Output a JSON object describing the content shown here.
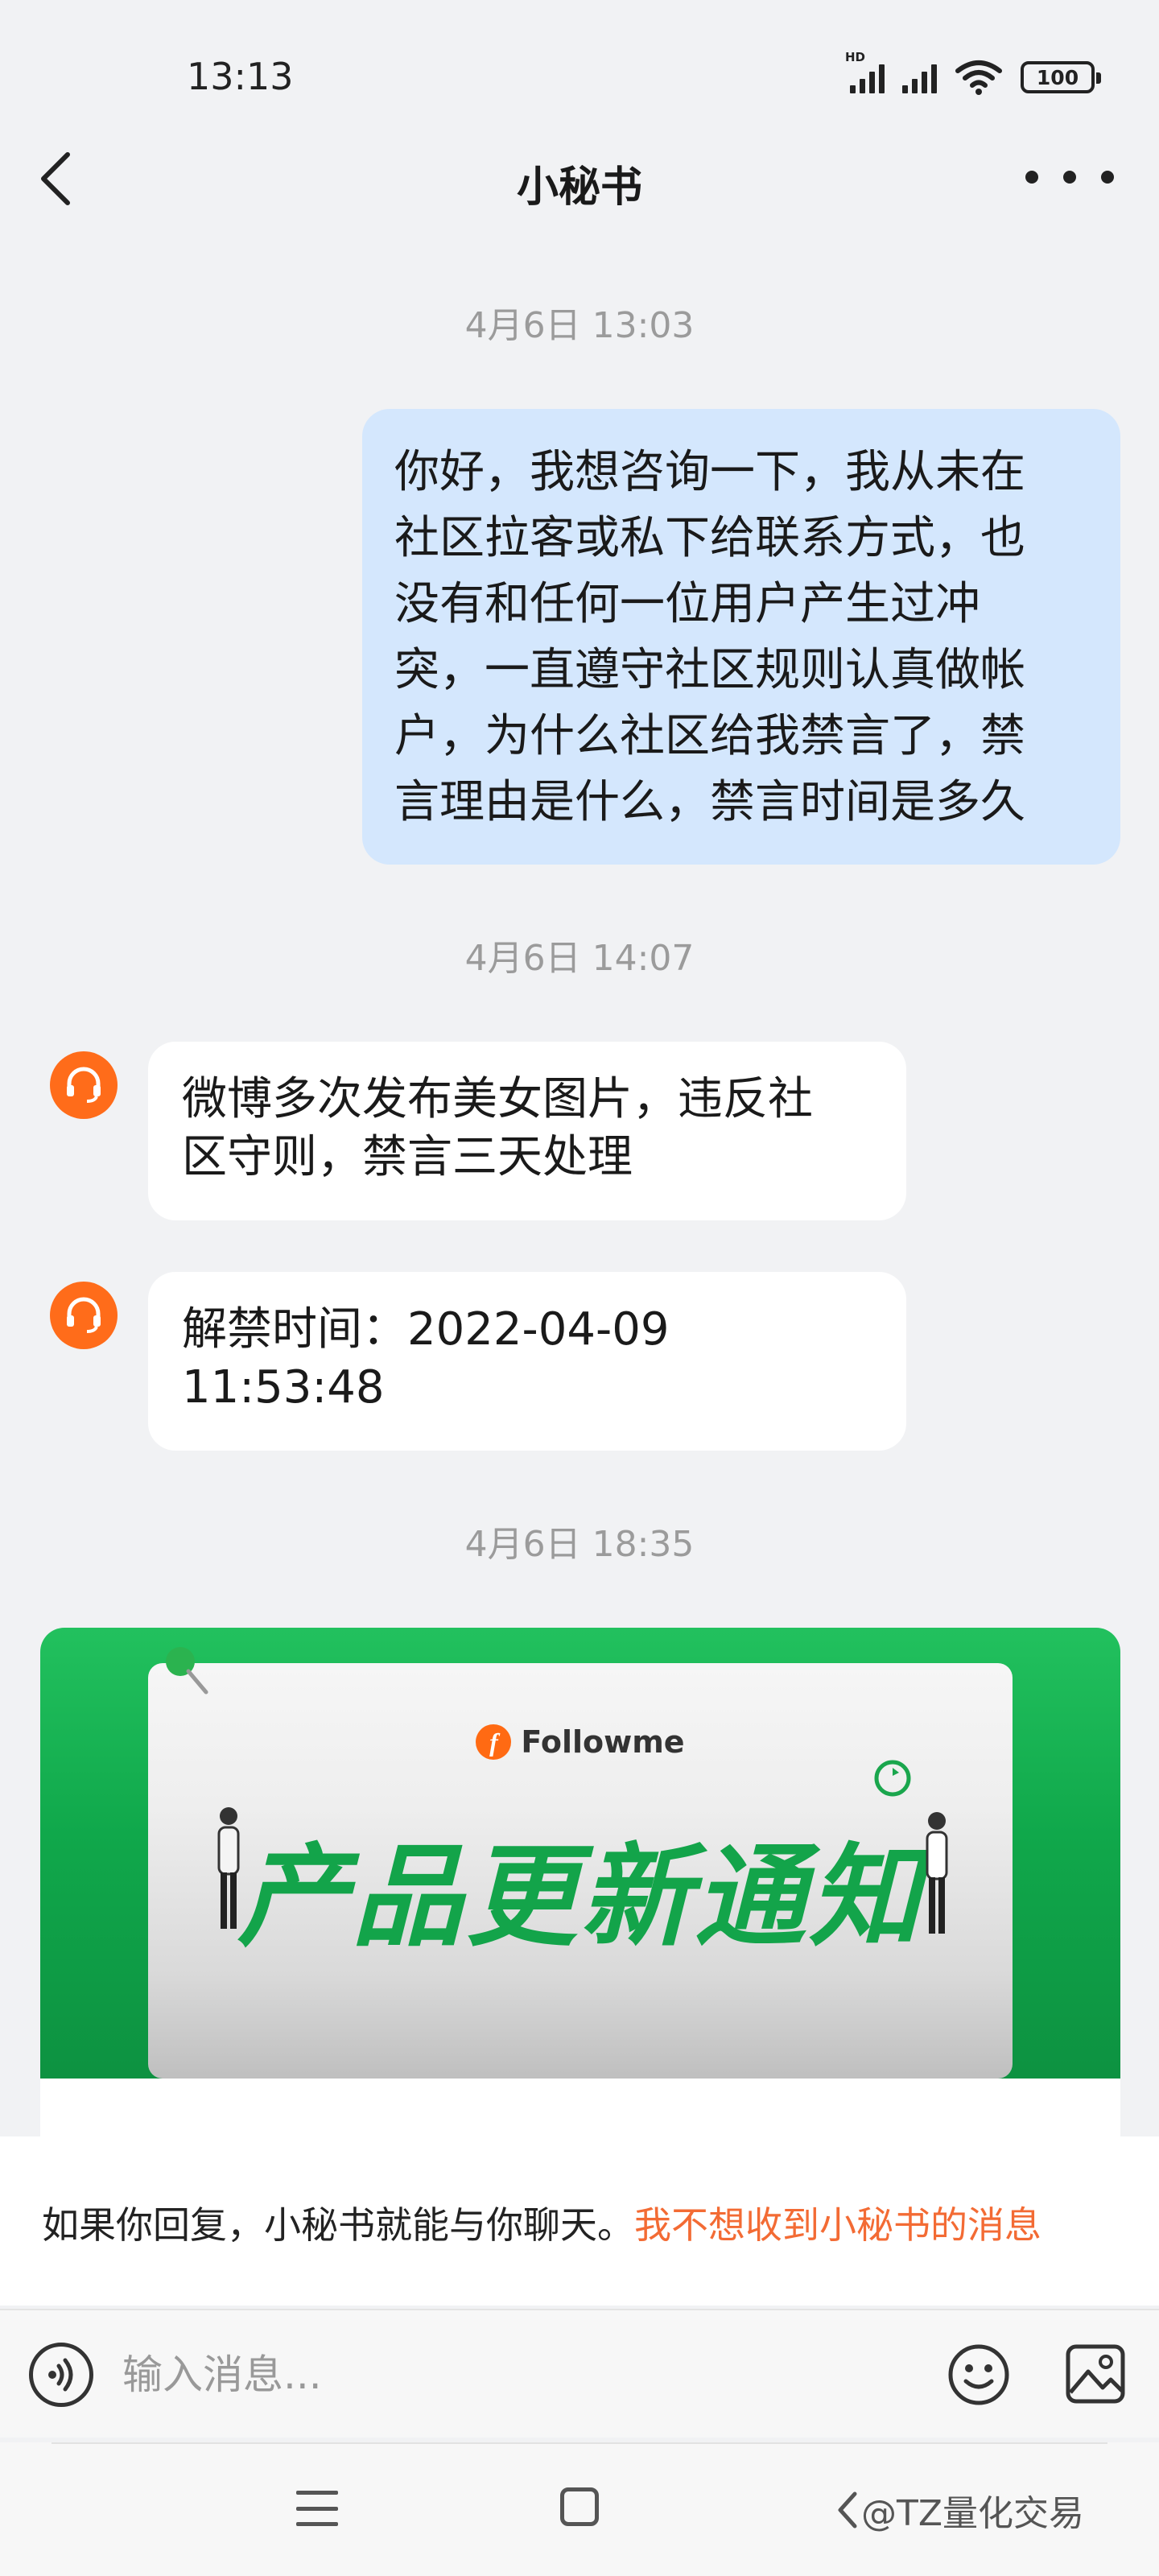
{
  "status_bar": {
    "time": "13:13",
    "network_label": "HD",
    "battery": "100"
  },
  "header": {
    "title": "小秘书"
  },
  "messages": {
    "ts1": "4月6日 13:03",
    "me_lines": [
      "你好，我想咨询一下，我从未在",
      "社区拉客或私下给联系方式，也",
      "没有和任何一位用户产生过冲",
      "突，一直遵守社区规则认真做帐",
      "户，为什么社区给我禁言了，禁",
      "言理由是什么，禁言时间是多久"
    ],
    "ts2": "4月6日 14:07",
    "reply1_lines": [
      "微博多次发布美女图片，违反社",
      "区守则，禁言三天处理"
    ],
    "reply2_lines": [
      "解禁时间：2022-04-09",
      "11:53:48"
    ],
    "ts3": "4月6日 18:35"
  },
  "promo_card": {
    "brand": "Followme",
    "brand_logo_letter": "f",
    "title": "产品更新通知"
  },
  "notice": {
    "text": "如果你回复，小秘书就能与你聊天。",
    "link": "我不想收到小秘书的消息"
  },
  "input": {
    "placeholder": "输入消息..."
  },
  "watermark": "@TZ量化交易",
  "colors": {
    "my_bubble": "#d4e7fd",
    "avatar": "#ff6c1a",
    "link": "#f36b34",
    "promo_green": "#13a44a"
  }
}
